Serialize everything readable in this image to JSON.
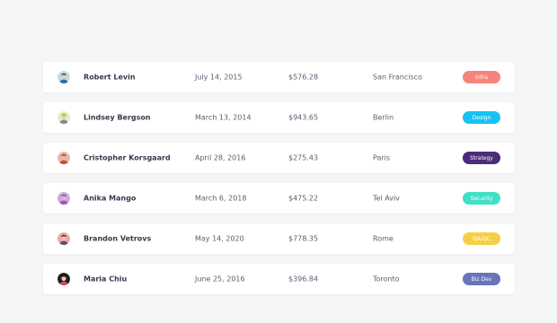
{
  "rows": [
    {
      "name": "Robert Levin",
      "date": "July 14, 2015",
      "amount": "$576.28",
      "city": "San Francisco",
      "tag": "Infra",
      "tag_color": "#f6847a",
      "avatar_bg": "#b8dcef",
      "skin": "#f2c9a8",
      "hair": "#4a3a33",
      "shirt": "#2e6ea6"
    },
    {
      "name": "Lindsey Bergson",
      "date": "March 13, 2014",
      "amount": "$943.65",
      "city": "Berlin",
      "tag": "Design",
      "tag_color": "#16c3f0",
      "avatar_bg": "#dff0c4",
      "skin": "#f3c8a4",
      "hair": "#c9983f",
      "shirt": "#7b8b99"
    },
    {
      "name": "Cristopher Korsgaard",
      "date": "April 28, 2016",
      "amount": "$275.43",
      "city": "Paris",
      "tag": "Strategy",
      "tag_color": "#4a2c78",
      "avatar_bg": "#f2b2a4",
      "skin": "#e6b89a",
      "hair": "#6b4b3a",
      "shirt": "#c24d3f"
    },
    {
      "name": "Anika Mango",
      "date": "March 6, 2018",
      "amount": "$475.22",
      "city": "Tel Aviv",
      "tag": "Security",
      "tag_color": "#3fe0c8",
      "avatar_bg": "#c9a8e8",
      "skin": "#e8b898",
      "hair": "#7a3f8f",
      "shirt": "#8a5cc0"
    },
    {
      "name": "Brandon Vetrovs",
      "date": "May 14, 2020",
      "amount": "$778.35",
      "city": "Rome",
      "tag": "QA/QC",
      "tag_color": "#f5cf49",
      "avatar_bg": "#f4a3a8",
      "skin": "#f0c2a0",
      "hair": "#3d2a24",
      "shirt": "#5f4a8b"
    },
    {
      "name": "Maria Chiu",
      "date": "June 25, 2016",
      "amount": "$396.84",
      "city": "Toronto",
      "tag": "Biz Dev",
      "tag_color": "#6a74b8",
      "avatar_bg": "#1e1e24",
      "skin": "#f3caa8",
      "hair": "#121214",
      "shirt": "#d94b5a"
    }
  ]
}
